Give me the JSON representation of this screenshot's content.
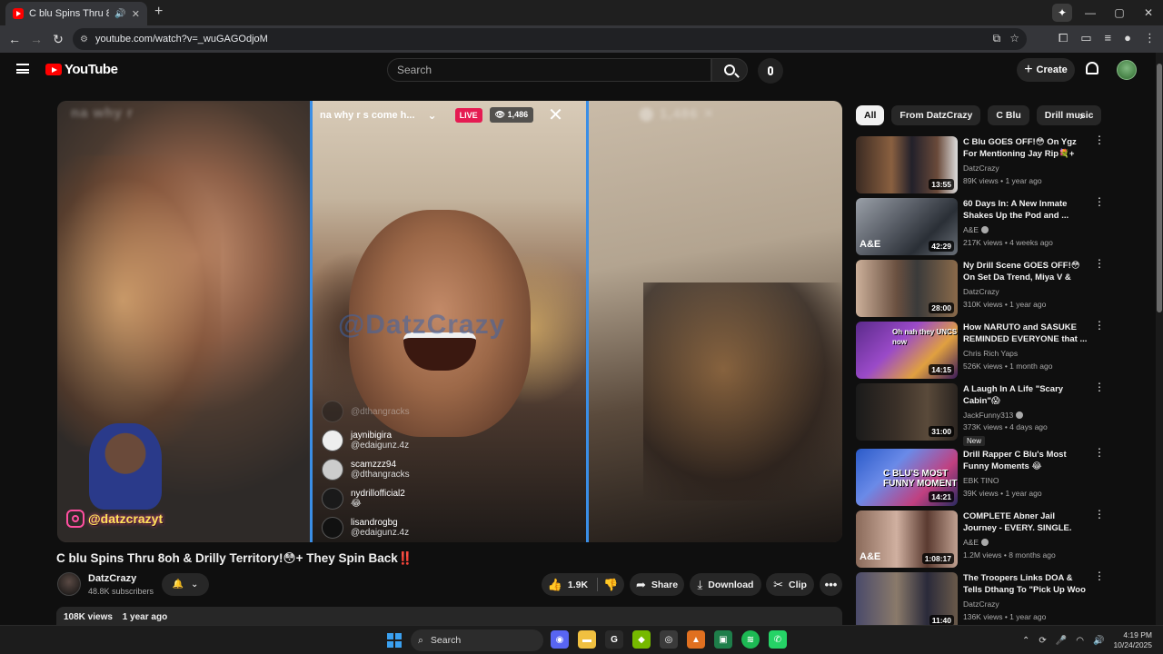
{
  "browser": {
    "tab_title": "C blu Spins Thru 8oh & Drilly",
    "url": "youtube.com/watch?v=_wuGAGOdjoM",
    "window_controls": [
      "—",
      "▢",
      "✕"
    ]
  },
  "youtube": {
    "logo_text": "YouTube",
    "search_placeholder": "Search",
    "create_label": "Create"
  },
  "player": {
    "live_header_text": "na why r     s come h...",
    "live_badge": "LIVE",
    "viewer_count": "1,486",
    "watermark": "@DatzCrazy",
    "instagram_handle": "@datzcrazyt",
    "comments": [
      {
        "name": "",
        "sub": "@dthangracks"
      },
      {
        "name": "jaynibigira",
        "sub": "@edaigunz.4z"
      },
      {
        "name": "scamzzz94",
        "sub": "@dthangracks"
      },
      {
        "name": "nydrillofficial2",
        "sub": "😂"
      },
      {
        "name": "lisandrogbg",
        "sub": "@edaigunz.4z"
      }
    ]
  },
  "video": {
    "title": "C blu Spins Thru 8oh & Drilly Territory!😳+ They Spin Back‼️",
    "channel": "DatzCrazy",
    "subscribers": "48.8K subscribers",
    "likes": "1.9K",
    "share_label": "Share",
    "download_label": "Download",
    "clip_label": "Clip",
    "views": "108K views",
    "age": "1 year ago"
  },
  "chips": [
    "All",
    "From DatzCrazy",
    "C Blu",
    "Drill music"
  ],
  "recommendations": [
    {
      "title": "C Blu GOES OFF!😳 On Ygz For Mentioning Jay Rip💐+ Flashy...",
      "channel": "DatzCrazy",
      "verified": false,
      "meta": "89K views • 1 year ago",
      "duration": "13:55",
      "badge": ""
    },
    {
      "title": "60 Days In: A New Inmate Shakes Up the Pod and ...",
      "channel": "A&E",
      "verified": true,
      "meta": "217K views • 4 weeks ago",
      "duration": "42:29",
      "badge": ""
    },
    {
      "title": "Ny Drill Scene GOES OFF!😳 On Set Da Trend, Miya V & Jaydot ...",
      "channel": "DatzCrazy",
      "verified": false,
      "meta": "310K views • 1 year ago",
      "duration": "28:00",
      "badge": ""
    },
    {
      "title": "How NARUTO and SASUKE REMINDED EVERYONE that ...",
      "channel": "Chris Rich Yaps",
      "verified": false,
      "meta": "526K views • 1 month ago",
      "duration": "14:15",
      "badge": ""
    },
    {
      "title": "A Laugh In A Life \"Scary Cabin\"😱",
      "channel": "JackFunny313",
      "verified": true,
      "meta": "373K views • 4 days ago",
      "duration": "31:00",
      "badge": "New"
    },
    {
      "title": "Drill Rapper C Blu's Most Funny Moments 😂",
      "channel": "EBK TINO",
      "verified": false,
      "meta": "39K views • 1 year ago",
      "duration": "14:21",
      "badge": ""
    },
    {
      "title": "COMPLETE Abner Jail Journey - EVERY. SINGLE. SCENE. - Part ...",
      "channel": "A&E",
      "verified": true,
      "meta": "1.2M views • 8 months ago",
      "duration": "1:08:17",
      "badge": ""
    },
    {
      "title": "The Troopers Links DOA & Tells Dthang To \"Pick Up Woo ...",
      "channel": "DatzCrazy",
      "verified": false,
      "meta": "136K views • 1 year ago",
      "duration": "11:40",
      "badge": ""
    }
  ],
  "thumb_captions": {
    "naruto": "Oh nah they UNCS now",
    "cblu": "C BLU'S MOST FUNNY MOMENT",
    "ae": "A&E"
  },
  "taskbar": {
    "search_label": "Search",
    "time": "4:19 PM",
    "date": "10/24/2025"
  },
  "colors": {
    "background": "#0f0f0f",
    "youtube_red": "#ff0000",
    "live_pink": "#e51b52",
    "split_border": "#3a8ee6"
  }
}
